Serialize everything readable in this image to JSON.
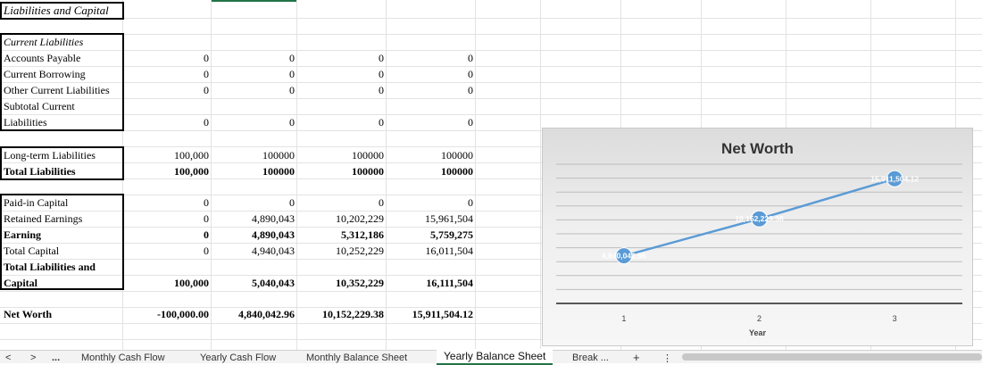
{
  "section_title": "Liabilities and Capital",
  "current_liabilities": {
    "header": "Current Liabilities",
    "rows": [
      {
        "label": "Accounts Payable",
        "values": [
          "0",
          "0",
          "0",
          "0"
        ]
      },
      {
        "label": "Current Borrowing",
        "values": [
          "0",
          "0",
          "0",
          "0"
        ]
      },
      {
        "label": "Other Current Liabilities",
        "values": [
          "0",
          "0",
          "0",
          "0"
        ]
      }
    ],
    "subtotal_label_1": "Subtotal Current",
    "subtotal_label_2": "Liabilities",
    "subtotal_values": [
      "0",
      "0",
      "0",
      "0"
    ]
  },
  "long_term": {
    "label": "Long-term Liabilities",
    "values": [
      "100,000",
      "100000",
      "100000",
      "100000"
    ],
    "total_label": "Total Liabilities",
    "total_values": [
      "100,000",
      "100000",
      "100000",
      "100000"
    ]
  },
  "capital": {
    "rows": [
      {
        "label": "Paid-in Capital",
        "values": [
          "0",
          "0",
          "0",
          "0"
        ],
        "bold": false
      },
      {
        "label": "Retained Earnings",
        "values": [
          "0",
          "4,890,043",
          "10,202,229",
          "15,961,504"
        ],
        "bold": false
      },
      {
        "label": "Earning",
        "values": [
          "0",
          "4,890,043",
          "5,312,186",
          "5,759,275"
        ],
        "bold": true
      },
      {
        "label": "Total Capital",
        "values": [
          "0",
          "4,940,043",
          "10,252,229",
          "16,011,504"
        ],
        "bold": false
      }
    ],
    "total_label_1": "Total Liabilities and",
    "total_label_2": "Capital",
    "total_values": [
      "100,000",
      "5,040,043",
      "10,352,229",
      "16,111,504"
    ]
  },
  "net_worth": {
    "label": "Net Worth",
    "values": [
      "-100,000.00",
      "4,840,042.96",
      "10,152,229.38",
      "15,911,504.12"
    ]
  },
  "chart_data": {
    "type": "line",
    "title": "Net Worth",
    "xlabel": "Year",
    "ylabel": "",
    "categories": [
      "1",
      "2",
      "3"
    ],
    "series": [
      {
        "values": [
          4840042.96,
          10152229.38,
          15911504.12
        ],
        "data_labels": [
          "4,840,042.96",
          "10,152,229.38",
          "15,911,504.12"
        ],
        "color": "#5b9bd5"
      }
    ],
    "ylim": [
      -2000000,
      18000000
    ],
    "grid": true,
    "legend": "none"
  },
  "sheet_tabs": {
    "nav_prev": "<",
    "nav_next": ">",
    "more": "...",
    "items": [
      "Monthly Cash Flow",
      "Yearly Cash Flow",
      "Monthly Balance Sheet",
      "Yearly Balance Sheet",
      "Break ..."
    ],
    "active": "Yearly Balance Sheet",
    "add": "+",
    "options": "⋮"
  }
}
